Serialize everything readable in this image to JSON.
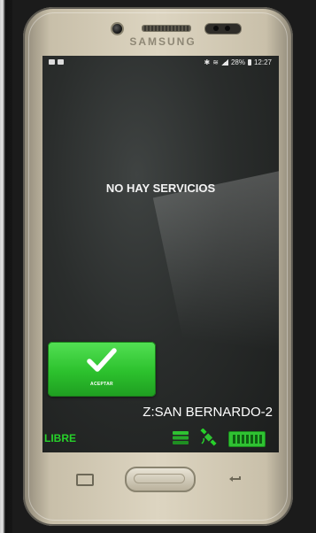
{
  "device": {
    "brand": "SAMSUNG"
  },
  "statusbar": {
    "battery": "28%",
    "time": "12:27"
  },
  "main": {
    "message": "NO HAY SERVICIOS",
    "accept_label": "ACEPTAR",
    "zone": "Z:SAN BERNARDO-2",
    "driver_status": "LIBRE"
  },
  "icons": {
    "accept": "checkmark-icon",
    "stack": "stack-icon",
    "gps": "satellite-icon",
    "card": "card-reader-icon"
  },
  "colors": {
    "accent_green": "#2cc12d",
    "status_green": "#27d12a",
    "screen_bg": "#2a2d2c"
  }
}
